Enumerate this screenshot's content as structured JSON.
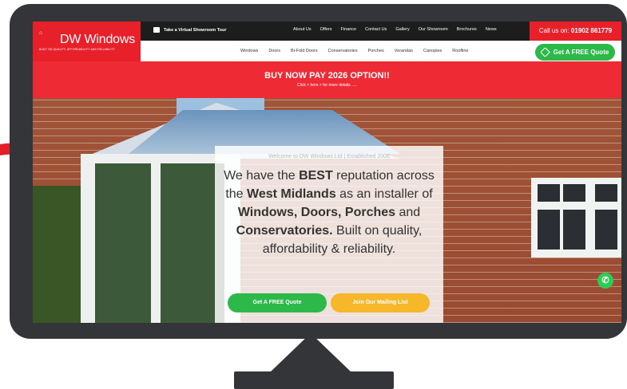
{
  "header": {
    "logo_house": "DW\nWINDOWS",
    "logo_name": "DW Windows",
    "logo_tagline": "BUILT ON QUALITY, AFFORDABILITY AND RELIABILITY",
    "tour_label": "Take a Virtual Showroom Tour",
    "top_links": [
      "About Us",
      "Offers",
      "Finance",
      "Contact Us",
      "Gallery",
      "Our Showroom",
      "Brochures",
      "News"
    ],
    "call_label": "Call us on:",
    "call_number": "01902 861779",
    "nav_links": [
      "Windows",
      "Doors",
      "Bi-Fold Doors",
      "Conservatories",
      "Porches",
      "Verandas",
      "Canopies",
      "Roofline"
    ],
    "quote_button": "Get A FREE Quote"
  },
  "promo": {
    "title": "BUY NOW PAY 2026 OPTION!!",
    "subtitle": "Click < here > for more details ....."
  },
  "hero": {
    "welcome": "Welcome to DW Windows Ltd | Established 2006",
    "headline_parts": [
      {
        "text": "We have the ",
        "bold": false
      },
      {
        "text": "BEST",
        "bold": true
      },
      {
        "text": " reputation across the ",
        "bold": false
      },
      {
        "text": "West Midlands",
        "bold": true
      },
      {
        "text": " as an installer of ",
        "bold": false
      },
      {
        "text": "Windows, Doors,",
        "bold": true
      },
      {
        "text": " ",
        "bold": false
      },
      {
        "text": "Porches",
        "bold": true
      },
      {
        "text": " and ",
        "bold": false
      },
      {
        "text": "Conservatories.",
        "bold": true
      },
      {
        "text": " Built on quality, affordability & reliability.",
        "bold": false
      }
    ],
    "quote_button": "Get A FREE Quote",
    "mailing_button": "Join Our Mailing List"
  },
  "colors": {
    "brand_red": "#e8202a",
    "green": "#2db84a",
    "yellow": "#f6b72b",
    "monitor": "#333539"
  },
  "icons": [
    "camera-icon",
    "tag-icon",
    "whatsapp-icon",
    "red-arrow"
  ]
}
